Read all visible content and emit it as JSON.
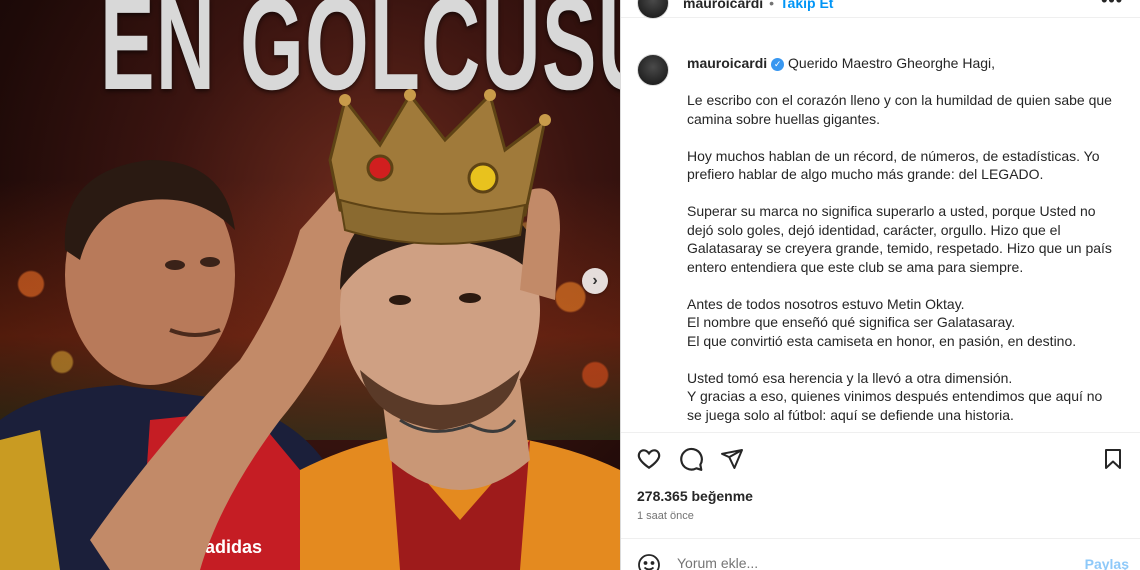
{
  "media": {
    "headline": "EN GOLCUSU",
    "jersey_brand": "adidas"
  },
  "header": {
    "username": "mauroicardi",
    "separator": "•",
    "follow_label": "Takip Et",
    "more_icon": "more-horizontal-icon"
  },
  "caption": {
    "username": "mauroicardi",
    "verified_icon": "verified-badge-icon",
    "paragraphs": [
      "Querido Maestro Gheorghe Hagi,",
      "Le escribo con el corazón lleno y con la humildad de quien sabe que camina sobre huellas gigantes.",
      "Hoy muchos hablan de un récord, de números, de estadísticas. Yo prefiero hablar de algo mucho más grande: del LEGADO.",
      "Superar su marca no significa superarlo a usted, porque Usted no dejó solo goles, dejó identidad, carácter, orgullo. Hizo que el Galatasaray se creyera grande, temido, respetado. Hizo que un país entero entendiera que este club se ama para siempre.",
      "Antes de todos nosotros estuvo Metin Oktay.",
      "El nombre que enseñó qué significa ser Galatasaray.",
      "El que convirtió esta camiseta en honor, en pasión, en destino.",
      "Usted tomó esa herencia y la llevó a otra dimensión.",
      "Y gracias a eso, quienes vinimos después entendimos que aquí no se juega solo al fútbol: aquí se defiende una historia."
    ]
  },
  "actions": {
    "like_icon": "heart-icon",
    "comment_icon": "comment-icon",
    "share_icon": "share-icon",
    "save_icon": "bookmark-icon"
  },
  "stats": {
    "likes": "278.365 beğenme",
    "time": "1 saat önce"
  },
  "comment": {
    "emoji_icon": "emoji-icon",
    "placeholder": "Yorum ekle...",
    "post_label": "Paylaş"
  },
  "carousel": {
    "next_icon": "chevron-right-icon"
  }
}
